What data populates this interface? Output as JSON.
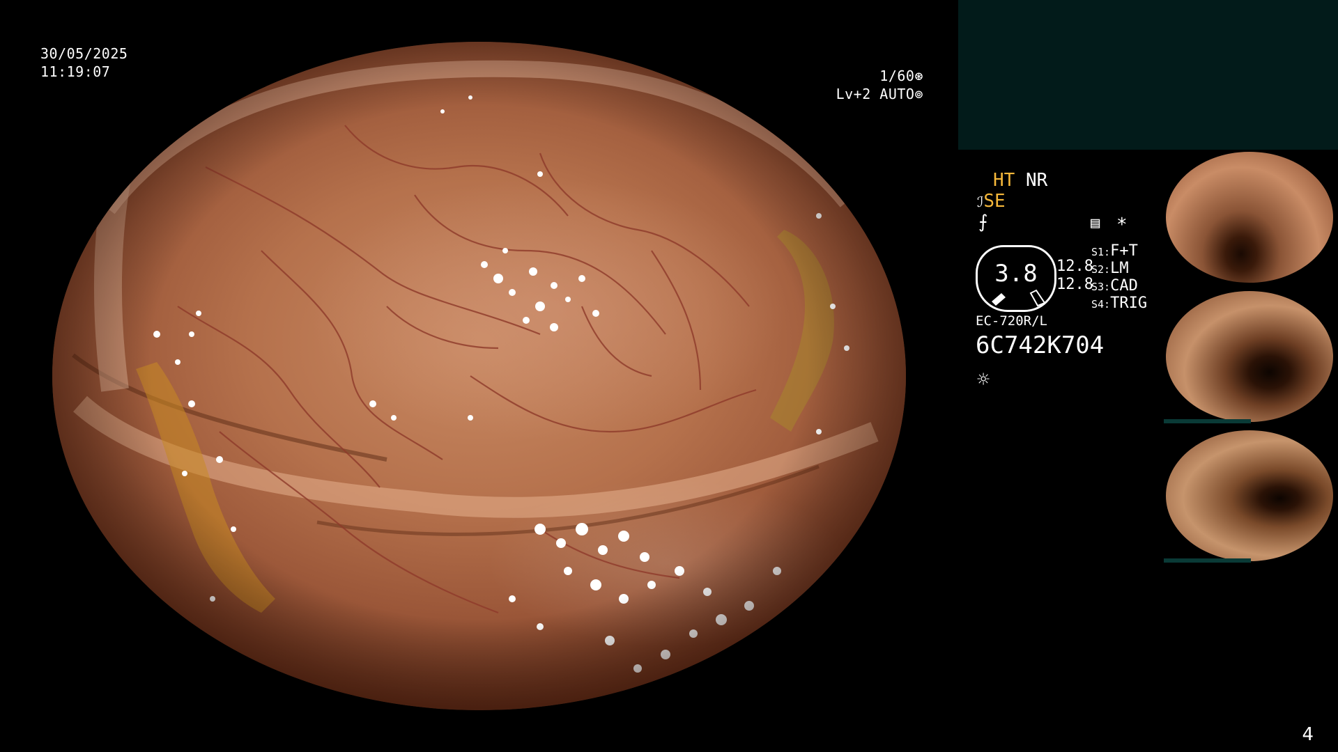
{
  "osd": {
    "date": "30/05/2025",
    "time": "11:19:07",
    "shutter": "1/60",
    "level": "Lv+2 AUTO"
  },
  "settings": {
    "ht": "HT",
    "nr": "NR",
    "se": "SE",
    "zoom": "3.8",
    "value_a": "12.8",
    "value_b": "12.8",
    "switches": [
      {
        "key": "S1:",
        "label": "F+T"
      },
      {
        "key": "S2:",
        "label": "LM"
      },
      {
        "key": "S3:",
        "label": "CAD"
      },
      {
        "key": "S4:",
        "label": "TRIG"
      }
    ],
    "scope_model": "EC-720R/L",
    "serial": "6C742K704",
    "asterisk": "*"
  },
  "icons": {
    "shutter_icon": "aperture-icon",
    "auto_icon": "iris-icon",
    "brightness_icon": "sun-icon",
    "menu_icon": "menu-box-icon"
  },
  "colors": {
    "accent_orange": "#f6b83a",
    "panel_teal": "#021b1a",
    "thumb_bar": "#0a3a36"
  },
  "page": {
    "number": "4"
  }
}
